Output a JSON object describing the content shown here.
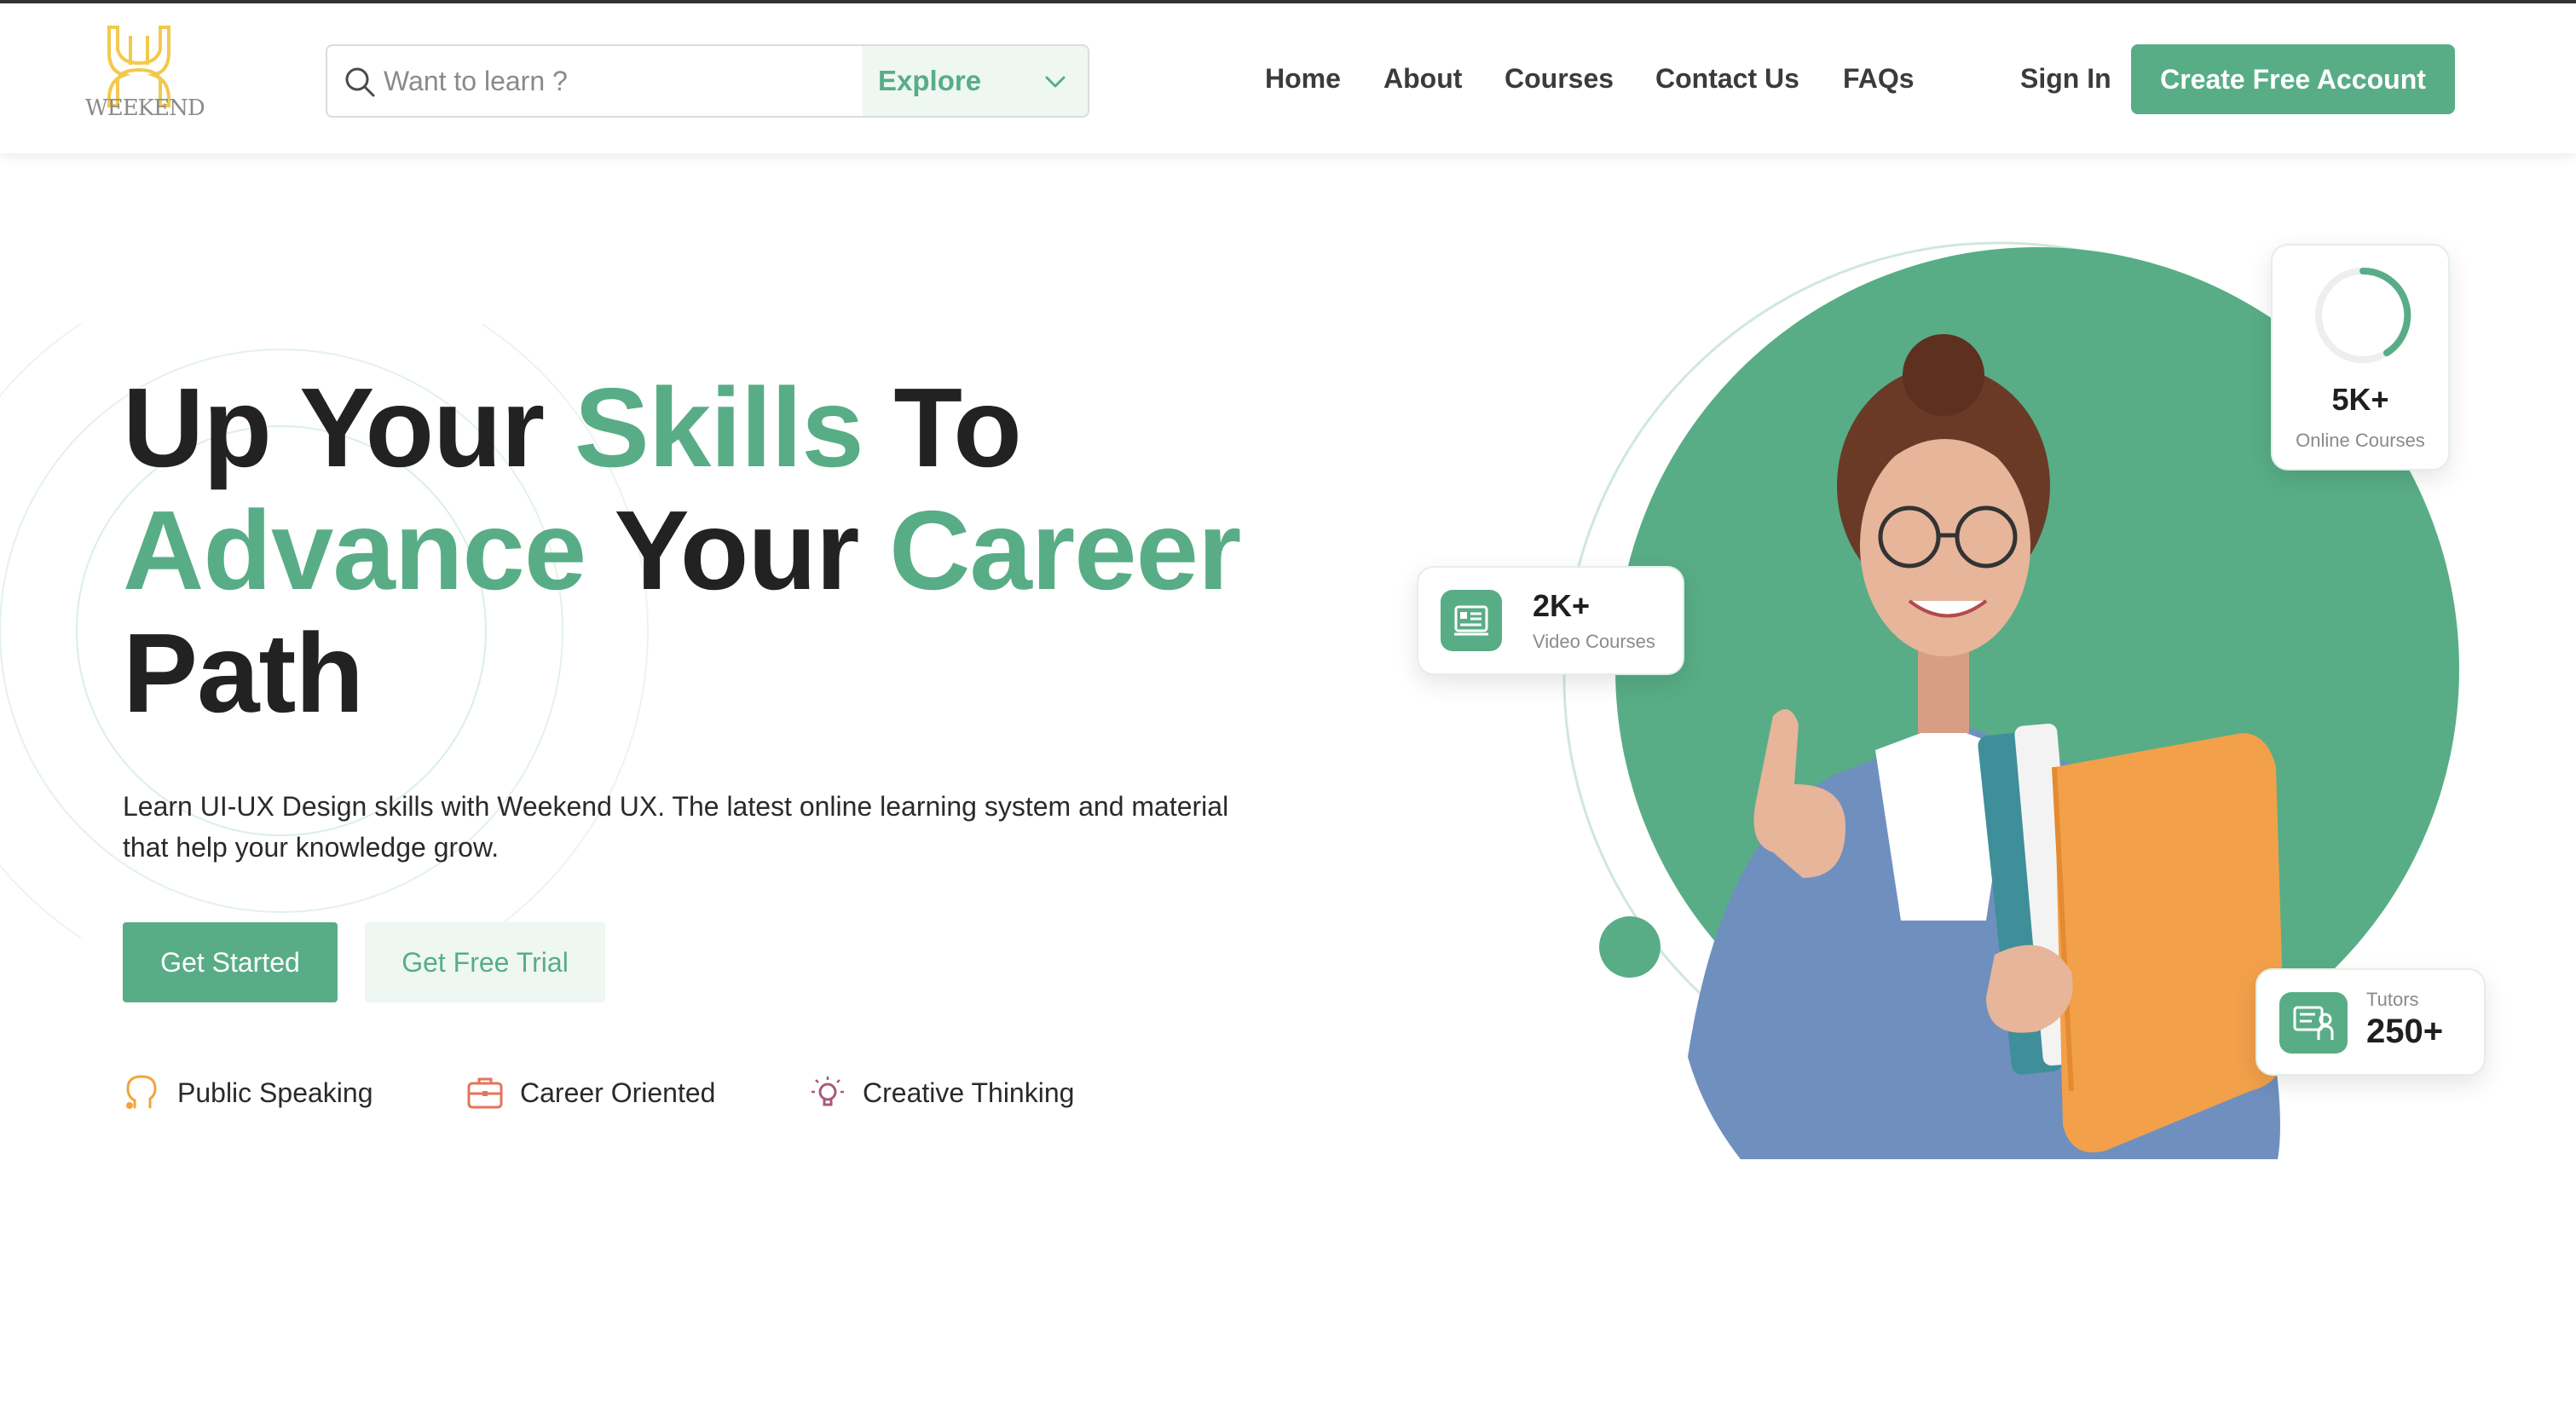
{
  "brand": {
    "logo_text": "WEEKEND",
    "accent": "#58ad86",
    "logo_color": "#f2c94c"
  },
  "search": {
    "placeholder": "Want to learn ?",
    "value": "",
    "explore_label": "Explore"
  },
  "nav": {
    "items": [
      "Home",
      "About",
      "Courses",
      "Contact Us",
      "FAQs"
    ]
  },
  "auth": {
    "signin_label": "Sign In",
    "cta_label": "Create Free Account"
  },
  "hero": {
    "title_parts": [
      {
        "text": "Up Your ",
        "accent": false
      },
      {
        "text": "Skills",
        "accent": true
      },
      {
        "text": " To",
        "accent": false
      },
      {
        "text": "Advance",
        "accent": true
      },
      {
        "text": " Your ",
        "accent": false
      },
      {
        "text": "Career",
        "accent": true
      },
      {
        "text": "Path",
        "accent": false
      }
    ],
    "description": "Learn UI-UX Design skills with Weekend UX. The latest online learning system and material that help your knowledge grow.",
    "primary_button": "Get Started",
    "secondary_button": "Get Free Trial",
    "features": [
      {
        "label": "Public Speaking",
        "icon": "speech-head-icon",
        "color": "#f2a53b"
      },
      {
        "label": "Career Oriented",
        "icon": "briefcase-icon",
        "color": "#e6735b"
      },
      {
        "label": "Creative Thinking",
        "icon": "lightbulb-icon",
        "color": "#a65b7b"
      }
    ]
  },
  "stats": {
    "online_courses": {
      "value": "5K+",
      "label": "Online Courses",
      "icon": "progress-ring-icon"
    },
    "video_courses": {
      "value": "2K+",
      "label": "Video Courses",
      "icon": "video-list-icon"
    },
    "tutors": {
      "value": "250+",
      "label": "Tutors",
      "icon": "tutor-board-icon"
    }
  }
}
